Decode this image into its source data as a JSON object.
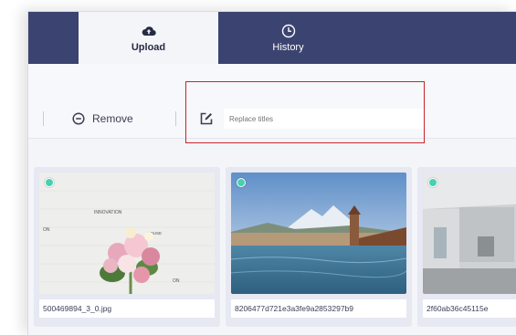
{
  "tabs": {
    "upload": {
      "label": "Upload",
      "icon": "cloud-upload-icon"
    },
    "history": {
      "label": "History",
      "icon": "clock-icon"
    }
  },
  "toolbar": {
    "remove_label": "Remove",
    "replace_placeholder": "Replace titles",
    "replace_value": ""
  },
  "images": [
    {
      "filename": "500469894_3_0.jpg",
      "icon": "selection-radio-icon"
    },
    {
      "filename": "8206477d721e3a3fe9a2853297b9",
      "icon": "selection-radio-icon"
    },
    {
      "filename": "2f60ab36c45115e",
      "icon": "selection-radio-icon"
    }
  ],
  "image_words": {
    "w1": "INNOVATION",
    "w2": "ON",
    "w3": "HOUSE",
    "w4": "ON"
  },
  "colors": {
    "header": "#3b4370",
    "highlight_border": "#c8232c",
    "radio": "#46d1b0"
  }
}
